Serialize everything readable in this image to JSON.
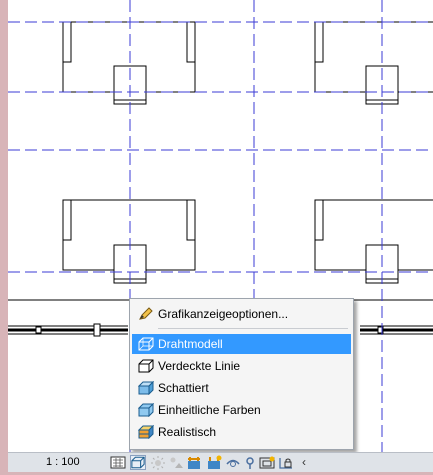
{
  "status_bar": {
    "scale_label": "1 : 100",
    "icons": [
      "detail-level-icon",
      "visual-style-icon",
      "sun-path-icon",
      "shadows-icon",
      "crop-view-icon",
      "show-crop-icon",
      "temporary-hide-icon",
      "reveal-hidden-icon",
      "analysis-icon",
      "lock-3d-icon",
      "collapse-arrow-icon"
    ]
  },
  "visual_style_menu": {
    "items": [
      {
        "label": "Grafikanzeigeoptionen...",
        "icon": "pencil-icon",
        "selected": false
      },
      {
        "label": "Drahtmodell",
        "icon": "wireframe-cube-icon",
        "selected": true
      },
      {
        "label": "Verdeckte Linie",
        "icon": "hidden-line-cube-icon",
        "selected": false
      },
      {
        "label": "Schattiert",
        "icon": "shaded-cube-icon",
        "selected": false
      },
      {
        "label": "Einheitliche Farben",
        "icon": "consistent-colors-cube-icon",
        "selected": false
      },
      {
        "label": "Realistisch",
        "icon": "realistic-cube-icon",
        "selected": false
      }
    ]
  },
  "colors": {
    "grid_line": "#3b3bd6",
    "menu_highlight": "#3399ff",
    "window_frame": "#d8b4b8"
  }
}
